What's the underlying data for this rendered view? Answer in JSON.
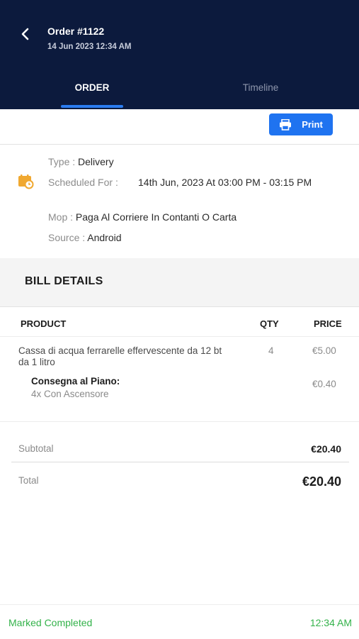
{
  "header": {
    "title": "Order #1122",
    "datetime": "14 Jun 2023 12:34 AM",
    "tabs": [
      {
        "label": "ORDER",
        "active": true
      },
      {
        "label": "Timeline",
        "active": false
      }
    ]
  },
  "actions": {
    "print_label": "Print"
  },
  "order_info": {
    "type_label": "Type :",
    "type_value": "Delivery",
    "scheduled_label": "Scheduled For :",
    "scheduled_value": "14th Jun, 2023 At 03:00 PM - 03:15 PM",
    "mop_label": "Mop :",
    "mop_value": "Paga Al Corriere In Contanti O Carta",
    "source_label": "Source :",
    "source_value": "Android"
  },
  "bill": {
    "title": "BILL DETAILS",
    "columns": [
      "PRODUCT",
      "QTY",
      "PRICE"
    ],
    "items": [
      {
        "name": "Cassa di acqua ferrarelle effervescente da 12 bt da 1 litro",
        "qty": "4",
        "price": "€5.00",
        "addon_title": "Consegna al Piano:",
        "addon_value": "4x Con Ascensore",
        "addon_price": "€0.40"
      }
    ],
    "subtotal_label": "Subtotal",
    "subtotal": "€20.40",
    "total_label": "Total",
    "total": "€20.40"
  },
  "footer": {
    "status": "Marked Completed",
    "time": "12:34 AM"
  },
  "colors": {
    "header_bg": "#0c1a3d",
    "accent": "#1f73f0",
    "success": "#33b24a"
  },
  "icons": {
    "back": "chevron-left-icon",
    "print": "printer-icon",
    "info": "calendar-clock-icon"
  }
}
